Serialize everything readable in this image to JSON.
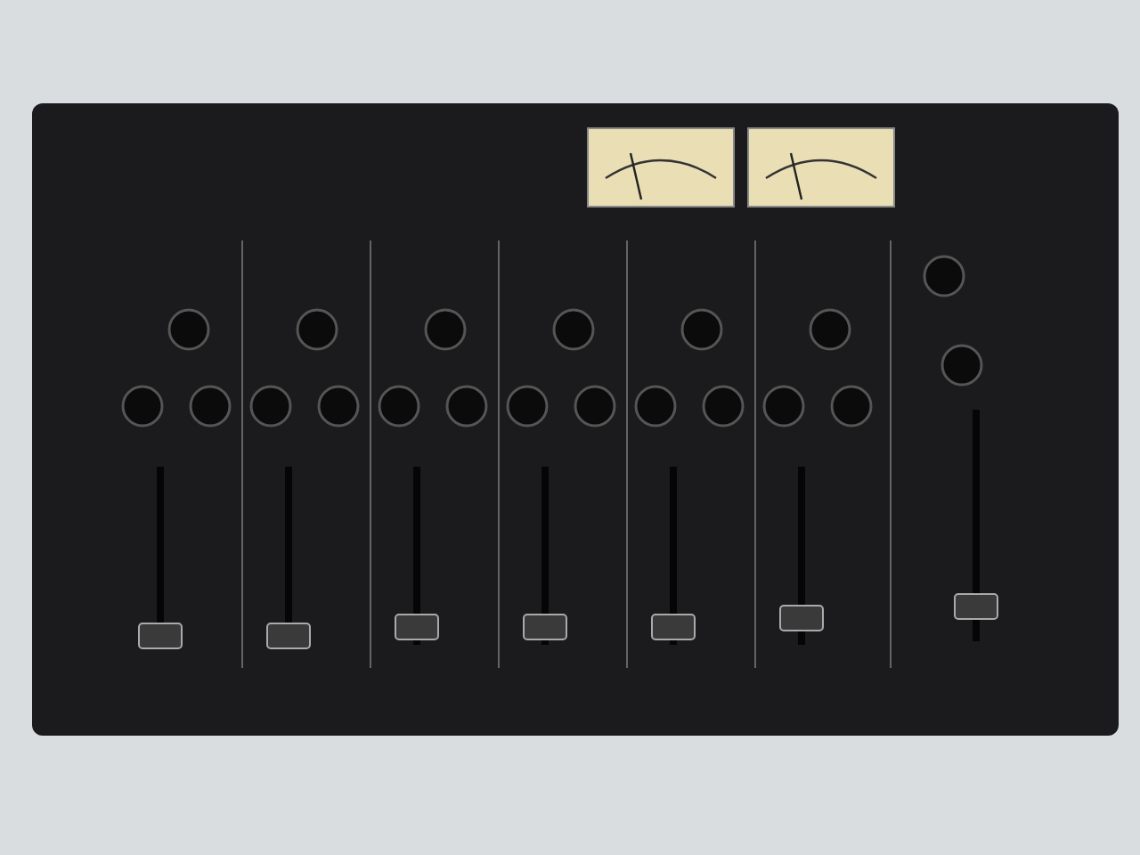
{
  "photo": {
    "kind": "mixer",
    "faders": [
      {
        "level": 0.05
      },
      {
        "level": 0.05
      },
      {
        "level": 0.1
      },
      {
        "level": 0.1
      },
      {
        "level": 0.1
      },
      {
        "level": 0.15
      },
      {
        "level": 0.15
      }
    ]
  }
}
